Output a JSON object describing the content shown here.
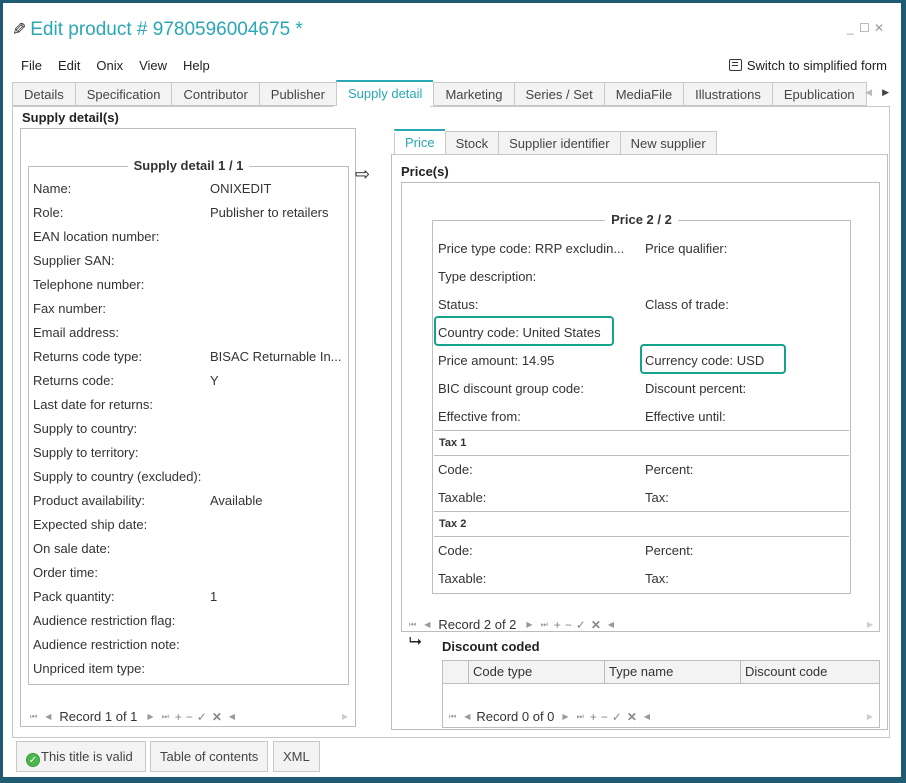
{
  "window": {
    "title": "Edit product # 9780596004675 *",
    "icon": "pencil-icon",
    "controls": {
      "minimize": "_",
      "maximize": "☐",
      "close": "✕"
    }
  },
  "menu": [
    "File",
    "Edit",
    "Onix",
    "View",
    "Help"
  ],
  "switch_form": {
    "label": "Switch to simplified form",
    "icon": "edit-form-icon"
  },
  "tabs": [
    {
      "label": "Details",
      "active": false
    },
    {
      "label": "Specification",
      "active": false
    },
    {
      "label": "Contributor",
      "active": false
    },
    {
      "label": "Publisher",
      "active": false
    },
    {
      "label": "Supply detail",
      "active": true
    },
    {
      "label": "Marketing",
      "active": false
    },
    {
      "label": "Series / Set",
      "active": false
    },
    {
      "label": "MediaFile",
      "active": false
    },
    {
      "label": "Illustrations",
      "active": false
    },
    {
      "label": "Epublication",
      "active": false
    }
  ],
  "accent_color": "#2aa7b5",
  "highlight_color": "#14a38b",
  "supply": {
    "section_title": "Supply detail(s)",
    "legend": "Supply detail 1 / 1",
    "fields": [
      {
        "label": "Name:",
        "value": "ONIXEDIT"
      },
      {
        "label": "Role:",
        "value": "Publisher to retailers"
      },
      {
        "label": "EAN location number:",
        "value": ""
      },
      {
        "label": "Supplier SAN:",
        "value": ""
      },
      {
        "label": "Telephone number:",
        "value": ""
      },
      {
        "label": "Fax number:",
        "value": ""
      },
      {
        "label": "Email address:",
        "value": ""
      },
      {
        "label": "Returns code type:",
        "value": "BISAC Returnable In..."
      },
      {
        "label": "Returns code:",
        "value": "Y"
      },
      {
        "label": "Last date for returns:",
        "value": ""
      },
      {
        "label": "Supply to country:",
        "value": ""
      },
      {
        "label": "Supply to territory:",
        "value": ""
      },
      {
        "label": "Supply to country (excluded):",
        "value": ""
      },
      {
        "label": "Product availability:",
        "value": "Available"
      },
      {
        "label": "Expected ship date:",
        "value": ""
      },
      {
        "label": "On sale date:",
        "value": ""
      },
      {
        "label": "Order time:",
        "value": ""
      },
      {
        "label": "Pack quantity:",
        "value": "1"
      },
      {
        "label": "Audience restriction flag:",
        "value": ""
      },
      {
        "label": "Audience restriction note:",
        "value": ""
      },
      {
        "label": "Unpriced item type:",
        "value": ""
      }
    ],
    "record_nav": "Record 1 of 1"
  },
  "subtabs": [
    {
      "label": "Price",
      "active": true
    },
    {
      "label": "Stock",
      "active": false
    },
    {
      "label": "Supplier identifier",
      "active": false
    },
    {
      "label": "New supplier",
      "active": false
    }
  ],
  "price": {
    "section_title": "Price(s)",
    "legend": "Price 2 / 2",
    "rows": [
      {
        "left": "Price type code:  RRP excludin...",
        "right": "Price qualifier:"
      },
      {
        "left": "Type description:",
        "right": ""
      },
      {
        "left": "Status:",
        "right": "Class of trade:"
      },
      {
        "left": "Country code:  United States",
        "right": ""
      },
      {
        "left": "Price amount:  14.95",
        "right": "Currency code:  USD"
      },
      {
        "left": "BIC discount group code:",
        "right": "Discount percent:"
      },
      {
        "left": "Effective from:",
        "right": "Effective until:"
      }
    ],
    "taxes": [
      {
        "title": "Tax 1",
        "code": "Code:",
        "percent": "Percent:",
        "taxable": "Taxable:",
        "tax": "Tax:"
      },
      {
        "title": "Tax 2",
        "code": "Code:",
        "percent": "Percent:",
        "taxable": "Taxable:",
        "tax": "Tax:"
      }
    ],
    "record_nav": "Record 2 of 2"
  },
  "discount": {
    "title": "Discount coded",
    "columns": [
      "Code type",
      "Type name",
      "Discount code"
    ],
    "rows": [],
    "record_nav": "Record 0 of 0"
  },
  "nav_glyphs": {
    "first": "⏮",
    "prev": "◀",
    "next": "▶",
    "last": "⏭",
    "add": "+",
    "remove": "−",
    "confirm": "✓",
    "cancel": "✕"
  },
  "footer_buttons": [
    {
      "label": "This title is valid",
      "icon": "valid-check-icon"
    },
    {
      "label": "Table of contents"
    },
    {
      "label": "XML"
    }
  ]
}
